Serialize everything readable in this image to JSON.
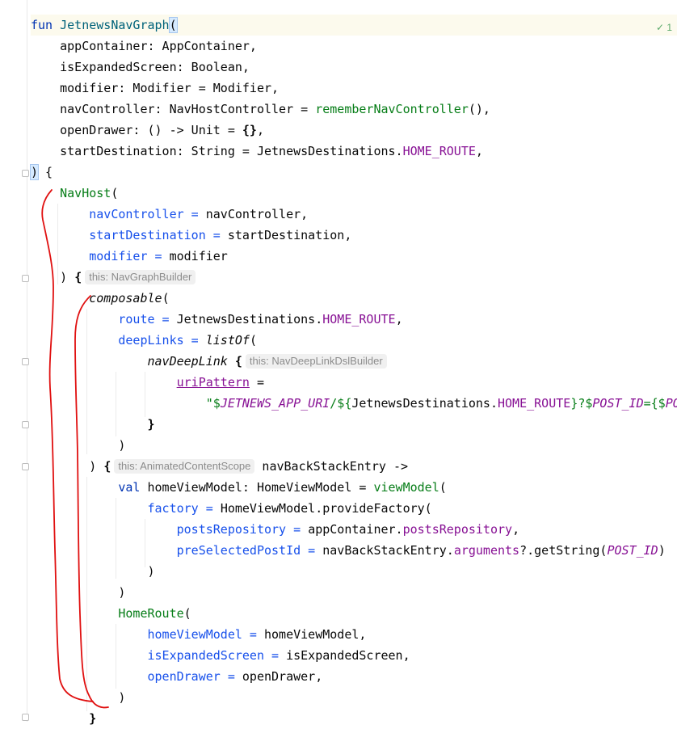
{
  "editor": {
    "inspection_status": "✓ 1",
    "lines": [
      {
        "tokens": [
          {
            "t": "fun ",
            "c": "kw"
          },
          {
            "t": "JetnewsNavGraph",
            "c": "fn"
          },
          {
            "t": "(",
            "c": "matched"
          }
        ]
      },
      {
        "tokens": [
          {
            "t": "    appContainer: AppContainer,"
          }
        ]
      },
      {
        "tokens": [
          {
            "t": "    isExpandedScreen: Boolean,"
          }
        ]
      },
      {
        "tokens": [
          {
            "t": "    modifier: Modifier = Modifier,"
          }
        ]
      },
      {
        "tokens": [
          {
            "t": "    navController: NavHostController = "
          },
          {
            "t": "rememberNavController",
            "c": "call"
          },
          {
            "t": "(),"
          }
        ]
      },
      {
        "tokens": [
          {
            "t": "    openDrawer: () -> Unit = "
          },
          {
            "t": "{}",
            "c": "bold"
          },
          {
            "t": ","
          }
        ]
      },
      {
        "tokens": [
          {
            "t": "    startDestination: String = JetnewsDestinations."
          },
          {
            "t": "HOME_ROUTE",
            "c": "const"
          },
          {
            "t": ","
          }
        ]
      },
      {
        "tokens": [
          {
            "t": ")",
            "c": "matched"
          },
          {
            "t": " {"
          }
        ]
      },
      {
        "tokens": [
          {
            "t": "    "
          },
          {
            "t": "NavHost",
            "c": "call"
          },
          {
            "t": "("
          }
        ]
      },
      {
        "tokens": [
          {
            "t": "        "
          },
          {
            "t": "navController",
            "c": "param"
          },
          {
            "t": " = ",
            "c": "param"
          },
          {
            "t": "navController,"
          }
        ]
      },
      {
        "tokens": [
          {
            "t": "        "
          },
          {
            "t": "startDestination",
            "c": "param"
          },
          {
            "t": " = ",
            "c": "param"
          },
          {
            "t": "startDestination,"
          }
        ]
      },
      {
        "tokens": [
          {
            "t": "        "
          },
          {
            "t": "modifier",
            "c": "param"
          },
          {
            "t": " = ",
            "c": "param"
          },
          {
            "t": "modifier"
          }
        ]
      },
      {
        "tokens": [
          {
            "t": "    ) "
          },
          {
            "t": "{",
            "c": "bold"
          },
          {
            "t": "this: NavGraphBuilder",
            "c": "hint"
          }
        ]
      },
      {
        "tokens": [
          {
            "t": "        "
          },
          {
            "t": "composable",
            "c": "ital"
          },
          {
            "t": "("
          }
        ]
      },
      {
        "tokens": [
          {
            "t": "            "
          },
          {
            "t": "route",
            "c": "param"
          },
          {
            "t": " = ",
            "c": "param"
          },
          {
            "t": "JetnewsDestinations."
          },
          {
            "t": "HOME_ROUTE",
            "c": "const"
          },
          {
            "t": ","
          }
        ]
      },
      {
        "tokens": [
          {
            "t": "            "
          },
          {
            "t": "deepLinks",
            "c": "param"
          },
          {
            "t": " = ",
            "c": "param"
          },
          {
            "t": "listOf",
            "c": "ital"
          },
          {
            "t": "("
          }
        ]
      },
      {
        "tokens": [
          {
            "t": "                "
          },
          {
            "t": "navDeepLink",
            "c": "ital"
          },
          {
            "t": " "
          },
          {
            "t": "{",
            "c": "bold"
          },
          {
            "t": "this: NavDeepLinkDslBuilder",
            "c": "hint"
          }
        ]
      },
      {
        "tokens": [
          {
            "t": "                    "
          },
          {
            "t": "uriPattern",
            "c": "const uline"
          },
          {
            "t": " ="
          }
        ]
      },
      {
        "tokens": [
          {
            "t": "                        "
          },
          {
            "t": "\"$",
            "c": "str"
          },
          {
            "t": "JETNEWS_APP_URI",
            "c": "italic-const"
          },
          {
            "t": "/${",
            "c": "str"
          },
          {
            "t": "JetnewsDestinations."
          },
          {
            "t": "HOME_ROUTE",
            "c": "const"
          },
          {
            "t": "}?$",
            "c": "str"
          },
          {
            "t": "POST_ID",
            "c": "italic-const"
          },
          {
            "t": "={$",
            "c": "str"
          },
          {
            "t": "PO",
            "c": "italic-const"
          }
        ]
      },
      {
        "tokens": [
          {
            "t": "                "
          },
          {
            "t": "}",
            "c": "bold"
          }
        ]
      },
      {
        "tokens": [
          {
            "t": "            )"
          }
        ]
      },
      {
        "tokens": [
          {
            "t": "        ) "
          },
          {
            "t": "{",
            "c": "bold"
          },
          {
            "t": "this: AnimatedContentScope",
            "c": "hint"
          },
          {
            "t": " navBackStackEntry ->"
          }
        ]
      },
      {
        "tokens": [
          {
            "t": "            "
          },
          {
            "t": "val ",
            "c": "kw"
          },
          {
            "t": "homeViewModel: HomeViewModel = "
          },
          {
            "t": "viewModel",
            "c": "call"
          },
          {
            "t": "("
          }
        ]
      },
      {
        "tokens": [
          {
            "t": "                "
          },
          {
            "t": "factory",
            "c": "param"
          },
          {
            "t": " = ",
            "c": "param"
          },
          {
            "t": "HomeViewModel.provideFactory("
          }
        ]
      },
      {
        "tokens": [
          {
            "t": "                    "
          },
          {
            "t": "postsRepository",
            "c": "param"
          },
          {
            "t": " = ",
            "c": "param"
          },
          {
            "t": "appContainer."
          },
          {
            "t": "postsRepository",
            "c": "const"
          },
          {
            "t": ","
          }
        ]
      },
      {
        "tokens": [
          {
            "t": "                    "
          },
          {
            "t": "preSelectedPostId",
            "c": "param"
          },
          {
            "t": " = ",
            "c": "param"
          },
          {
            "t": "navBackStackEntry."
          },
          {
            "t": "arguments",
            "c": "const"
          },
          {
            "t": "?.getString("
          },
          {
            "t": "POST_ID",
            "c": "italic-const"
          },
          {
            "t": ")"
          }
        ]
      },
      {
        "tokens": [
          {
            "t": "                )"
          }
        ]
      },
      {
        "tokens": [
          {
            "t": "            )"
          }
        ]
      },
      {
        "tokens": [
          {
            "t": "            "
          },
          {
            "t": "HomeRoute",
            "c": "call"
          },
          {
            "t": "("
          }
        ]
      },
      {
        "tokens": [
          {
            "t": "                "
          },
          {
            "t": "homeViewModel",
            "c": "param"
          },
          {
            "t": " = ",
            "c": "param"
          },
          {
            "t": "homeViewModel,"
          }
        ]
      },
      {
        "tokens": [
          {
            "t": "                "
          },
          {
            "t": "isExpandedScreen",
            "c": "param"
          },
          {
            "t": " = ",
            "c": "param"
          },
          {
            "t": "isExpandedScreen,"
          }
        ]
      },
      {
        "tokens": [
          {
            "t": "                "
          },
          {
            "t": "openDrawer",
            "c": "param"
          },
          {
            "t": " = ",
            "c": "param"
          },
          {
            "t": "openDrawer,"
          }
        ]
      },
      {
        "tokens": [
          {
            "t": "            )"
          }
        ]
      },
      {
        "tokens": [
          {
            "t": "        "
          },
          {
            "t": "}",
            "c": "bold"
          }
        ]
      }
    ]
  }
}
